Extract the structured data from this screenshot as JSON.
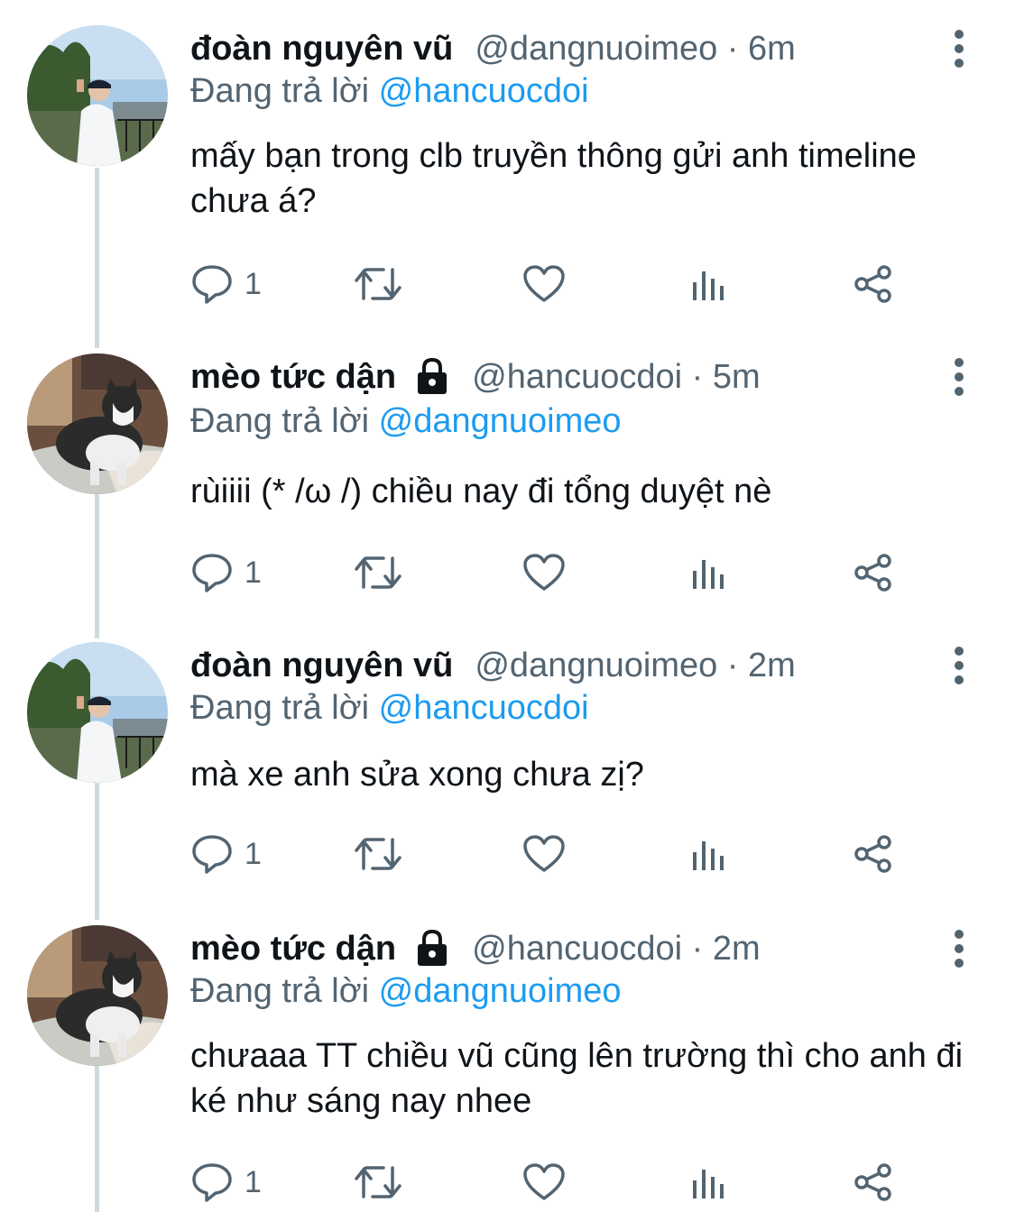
{
  "colors": {
    "accent": "#1d9bf0",
    "secondary_text": "#536471",
    "primary_text": "#0f1419",
    "thread_line": "#cfd9de"
  },
  "tweets": [
    {
      "name": "đoàn nguyên vũ",
      "handle_time": "@dangnuoimeo · 6m",
      "reply_prefix": "Đang trả lời",
      "reply_mention": "@hancuocdoi",
      "text": "mấy bạn trong clb truyền thông gửi anh timeline chưa á?",
      "reply_count": "1",
      "locked": false,
      "avatar_icon": "person-photo-avatar"
    },
    {
      "name": "mèo tức dận",
      "handle_time": "@hancuocdoi · 5m",
      "reply_prefix": "Đang trả lời",
      "reply_mention": "@dangnuoimeo",
      "text": "rùiiii (* /ω /) chiều nay đi tổng duyệt nè",
      "reply_count": "1",
      "locked": true,
      "avatar_icon": "cat-photo-avatar"
    },
    {
      "name": "đoàn nguyên vũ",
      "handle_time": "@dangnuoimeo · 2m",
      "reply_prefix": "Đang trả lời",
      "reply_mention": "@hancuocdoi",
      "text": "mà xe anh sửa xong chưa zị?",
      "reply_count": "1",
      "locked": false,
      "avatar_icon": "person-photo-avatar"
    },
    {
      "name": "mèo tức dận",
      "handle_time": "@hancuocdoi · 2m",
      "reply_prefix": "Đang trả lời",
      "reply_mention": "@dangnuoimeo",
      "text": "chưaaa TT chiều vũ cũng lên trường thì cho anh đi ké như sáng nay nhee",
      "reply_count": "1",
      "locked": true,
      "avatar_icon": "cat-photo-avatar"
    }
  ]
}
